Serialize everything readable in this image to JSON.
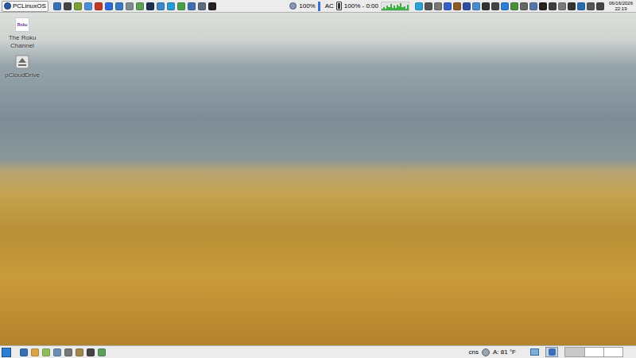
{
  "top_panel": {
    "menu_button": "PCLinuxOS",
    "volume": {
      "reading": "100%",
      "level": 1
    },
    "power": {
      "source": "AC",
      "reading": "100% - 0:00",
      "level": 1
    },
    "cpu_graph": {
      "values": [
        20,
        35,
        15,
        60,
        40,
        80,
        30,
        55,
        25,
        70,
        45,
        90,
        35,
        50,
        20,
        65
      ]
    },
    "clock": {
      "date": "06/16/2026",
      "time": "22:19"
    }
  },
  "desktop": {
    "icons": [
      {
        "label": "The Roku Channel",
        "logo_text": "Roku",
        "kind": "roku"
      },
      {
        "label": "pCloudDrive",
        "kind": "drive"
      }
    ]
  },
  "bottom_panel": {
    "tray": {
      "keyboard_layout": "cns",
      "weather": "A: 81 °F"
    },
    "tasks": [
      {
        "selected": true
      }
    ],
    "workspaces": [
      {
        "selected": true
      },
      {
        "selected": false
      },
      {
        "selected": false
      }
    ]
  }
}
